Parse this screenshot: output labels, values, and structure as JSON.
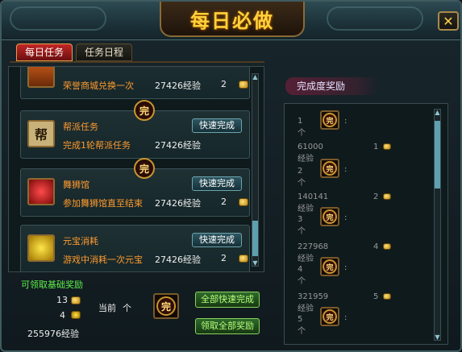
{
  "title": "每日必做",
  "close_label": "✕",
  "tabs": [
    {
      "label": "每日任务",
      "active": true
    },
    {
      "label": "任务日程",
      "active": false
    }
  ],
  "tasks": [
    {
      "name": "",
      "desc": "荣誉商城兑换一次",
      "exp": "27426经验",
      "count": "2",
      "icon": "scroll-icon",
      "quick": "",
      "done": false
    },
    {
      "name": "帮派任务",
      "desc": "完成1轮帮派任务",
      "exp": "27426经验",
      "count": "",
      "icon": "guild-icon",
      "icon_char": "帮",
      "quick": "快速完成",
      "done": true
    },
    {
      "name": "舞狮馆",
      "desc": "参加舞狮馆直至结束",
      "exp": "27426经验",
      "count": "2",
      "icon": "lion-icon",
      "quick": "快速完成",
      "done": true
    },
    {
      "name": "元宝消耗",
      "desc": "游戏中消耗一次元宝",
      "exp": "27426经验",
      "count": "2",
      "icon": "gold-ingot-icon",
      "quick": "快速完成",
      "done": false
    }
  ],
  "done_char": "完",
  "basic_reward": {
    "title": "可领取基础奖励",
    "count1": "13",
    "count2": "4",
    "exp": "255976经验"
  },
  "current": {
    "label": "当前",
    "count": "个"
  },
  "buttons": {
    "complete_all": "全部快速完成",
    "claim_all": "领取全部奖励"
  },
  "reward_title": "完成度奖励",
  "rewards": [
    {
      "label": "1个",
      "exp": "",
      "num": ""
    },
    {
      "label": "2个",
      "exp": "61000经验",
      "num": "1"
    },
    {
      "label": "3个",
      "exp": "140141经验",
      "num": "2"
    },
    {
      "label": "4个",
      "exp": "227968经验",
      "num": "4"
    },
    {
      "label": "5个",
      "exp": "321959经验",
      "num": "5"
    }
  ],
  "colors": {
    "accent": "#ffd23a",
    "task_text": "#ff9a2e",
    "basic": "#5df04c"
  }
}
